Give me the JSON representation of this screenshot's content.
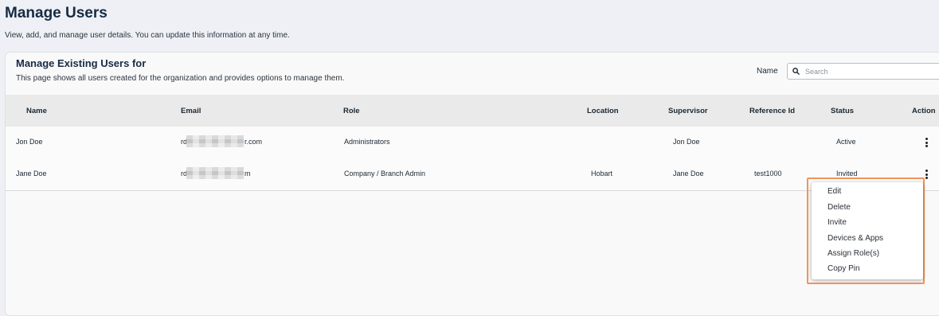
{
  "header": {
    "title": "Manage Users",
    "subtitle": "View, add, and manage user details. You can update this information at any time."
  },
  "card": {
    "title": "Manage Existing Users for",
    "description": "This page shows all users created for the organization and provides options to manage them."
  },
  "search": {
    "label": "Name",
    "placeholder": "Search",
    "value": ""
  },
  "table": {
    "columns": {
      "name": "Name",
      "email": "Email",
      "role": "Role",
      "location": "Location",
      "supervisor": "Supervisor",
      "reference_id": "Reference Id",
      "status": "Status",
      "action": "Action"
    },
    "rows": [
      {
        "name": "Jon Doe",
        "email_prefix": "rd",
        "email_suffix": "r.com",
        "role": "Administrators",
        "location": "",
        "supervisor": "Jon Doe",
        "reference_id": "",
        "status": "Active"
      },
      {
        "name": "Jane Doe",
        "email_prefix": "rd",
        "email_suffix": "m",
        "role": "Company / Branch Admin",
        "location": "Hobart",
        "supervisor": "Jane Doe",
        "reference_id": "test1000",
        "status": "Invited"
      }
    ]
  },
  "action_menu": {
    "items": [
      "Edit",
      "Delete",
      "Invite",
      "Devices & Apps",
      "Assign Role(s)",
      "Copy Pin"
    ]
  },
  "colors": {
    "page_background": "#eef0f5",
    "title": "#162b44",
    "menu_highlight_border": "#f0955b"
  },
  "icons": [
    "search-icon",
    "kebab-menu-icon"
  ]
}
